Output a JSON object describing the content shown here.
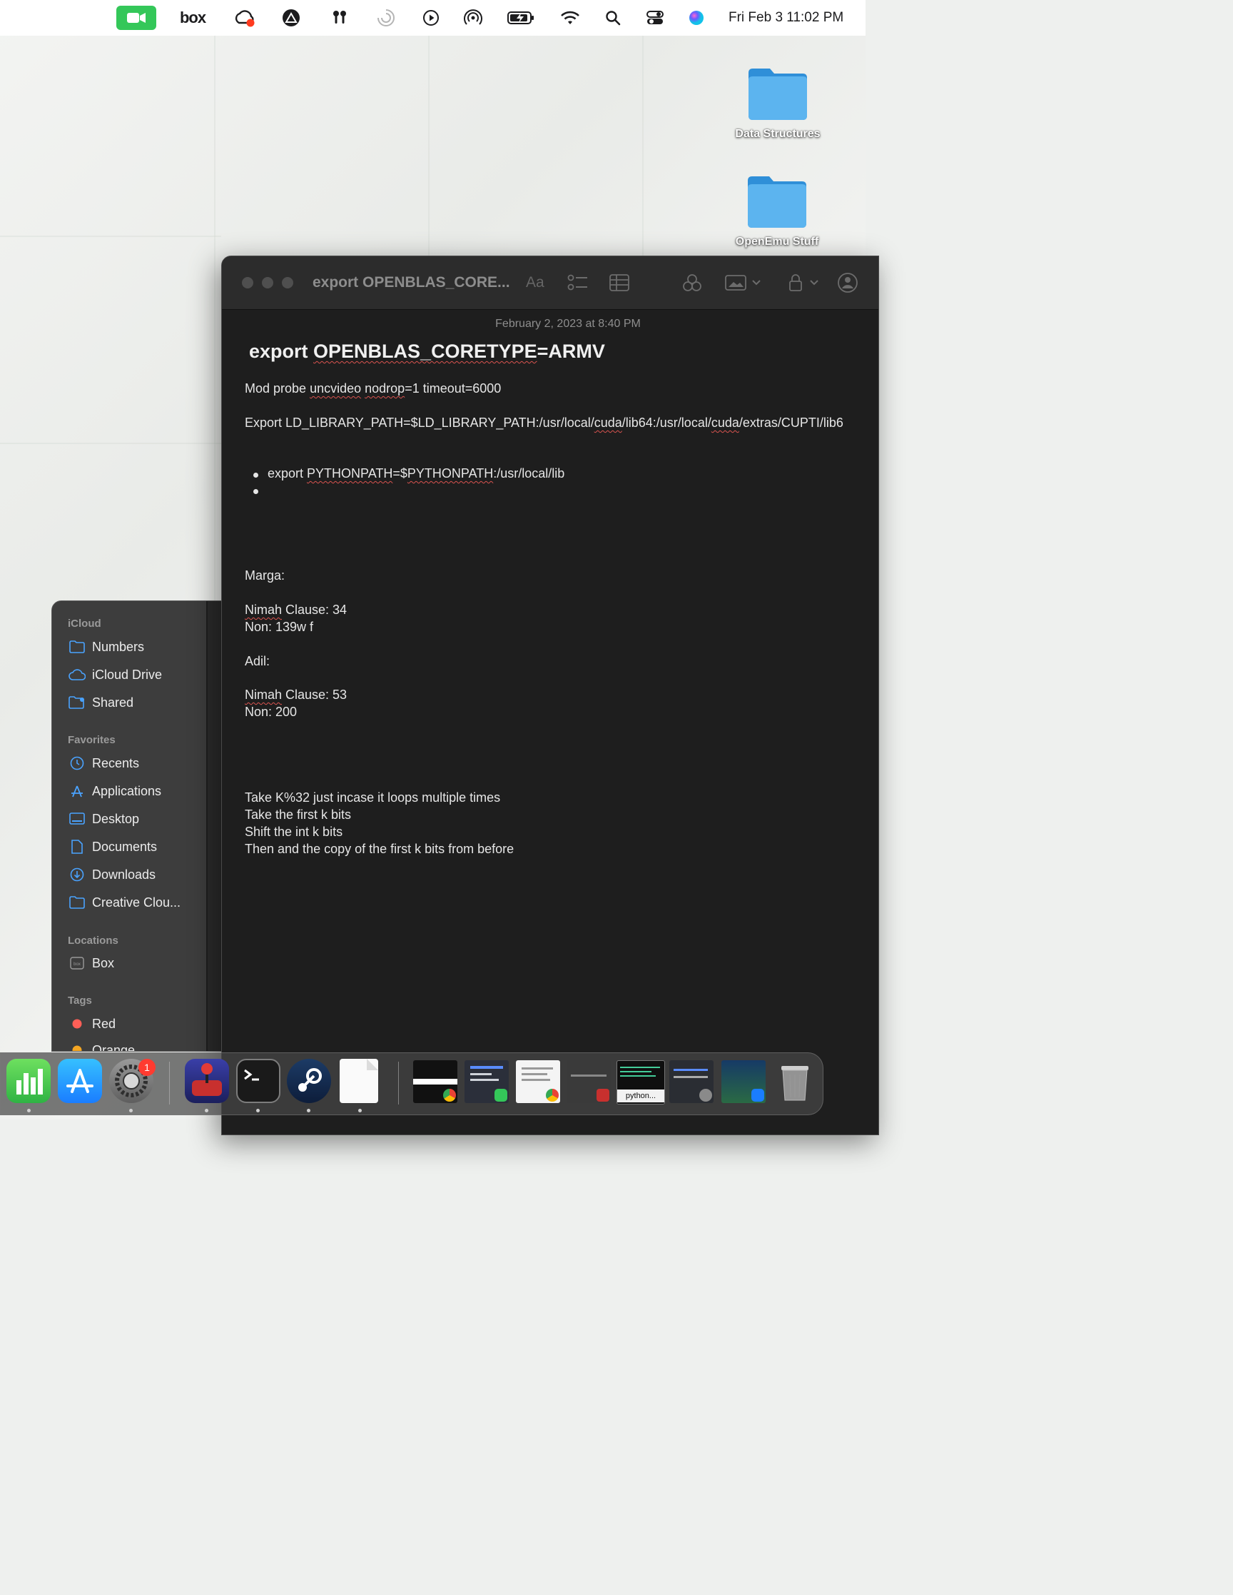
{
  "menubar": {
    "clock": "Fri Feb 3  11:02 PM",
    "box_label": "box",
    "icons": [
      "facetime-icon",
      "box-icon",
      "creative-cloud-icon",
      "vpn-icon",
      "airpods-icon",
      "loading-icon",
      "play-icon",
      "airdrop-icon",
      "battery-icon",
      "wifi-icon",
      "spotlight-icon",
      "control-center-icon",
      "siri-icon"
    ]
  },
  "desktop": {
    "folders": [
      {
        "label": "Data Structures"
      },
      {
        "label": "OpenEmu Stuff"
      }
    ]
  },
  "notes": {
    "window_title": "export OPENBLAS_CORE...",
    "format_label": "Aa",
    "date": "February 2, 2023 at 8:40 PM",
    "title_pre": "export ",
    "title_u": "OPENBLAS_CORETYPE",
    "title_post": "=ARMV",
    "line1_a": "Mod probe ",
    "line1_b": "uncvideo",
    "line1_c": " ",
    "line1_d": "nodrop",
    "line1_e": "=1 timeout=6000",
    "line2_a": "Export LD_LIBRARY_PATH=$LD_LIBRARY_PATH:/usr/local/",
    "line2_b": "cuda",
    "line2_c": "/lib64:/usr/local/",
    "line2_d": "cuda",
    "line2_e": "/extras/CUPTI/lib6",
    "bullet1_a": "export ",
    "bullet1_b": "PYTHONPATH",
    "bullet1_c": "=$",
    "bullet1_d": "PYTHONPATH",
    "bullet1_e": ":/usr/local/lib",
    "marga": "Marga:",
    "marga_clause_a": "Nimah",
    "marga_clause_b": " Clause: 34",
    "marga_non": "Non: 139w f",
    "adil": "Adil:",
    "adil_clause_a": "Nimah",
    "adil_clause_b": " Clause: 53",
    "adil_non": "Non: 200",
    "step1": "Take K%32 just incase it loops multiple times",
    "step2": "Take the first k bits",
    "step3": "Shift the int k bits",
    "step4": "Then and the copy of the first k bits from before"
  },
  "finder": {
    "sections": {
      "icloud": "iCloud",
      "favorites": "Favorites",
      "locations": "Locations",
      "tags": "Tags"
    },
    "icloud_items": [
      "Numbers",
      "iCloud Drive",
      "Shared"
    ],
    "favorite_items": [
      "Recents",
      "Applications",
      "Desktop",
      "Documents",
      "Downloads",
      "Creative Clou..."
    ],
    "location_items": [
      "Box"
    ],
    "tag_items": [
      "Red",
      "Orange"
    ],
    "colors": {
      "accent": "#4aa3ff",
      "red_tag": "#ff5f57",
      "orange_tag": "#f5a623"
    }
  },
  "dock": {
    "badge_count": "1",
    "python_label": "python..."
  }
}
